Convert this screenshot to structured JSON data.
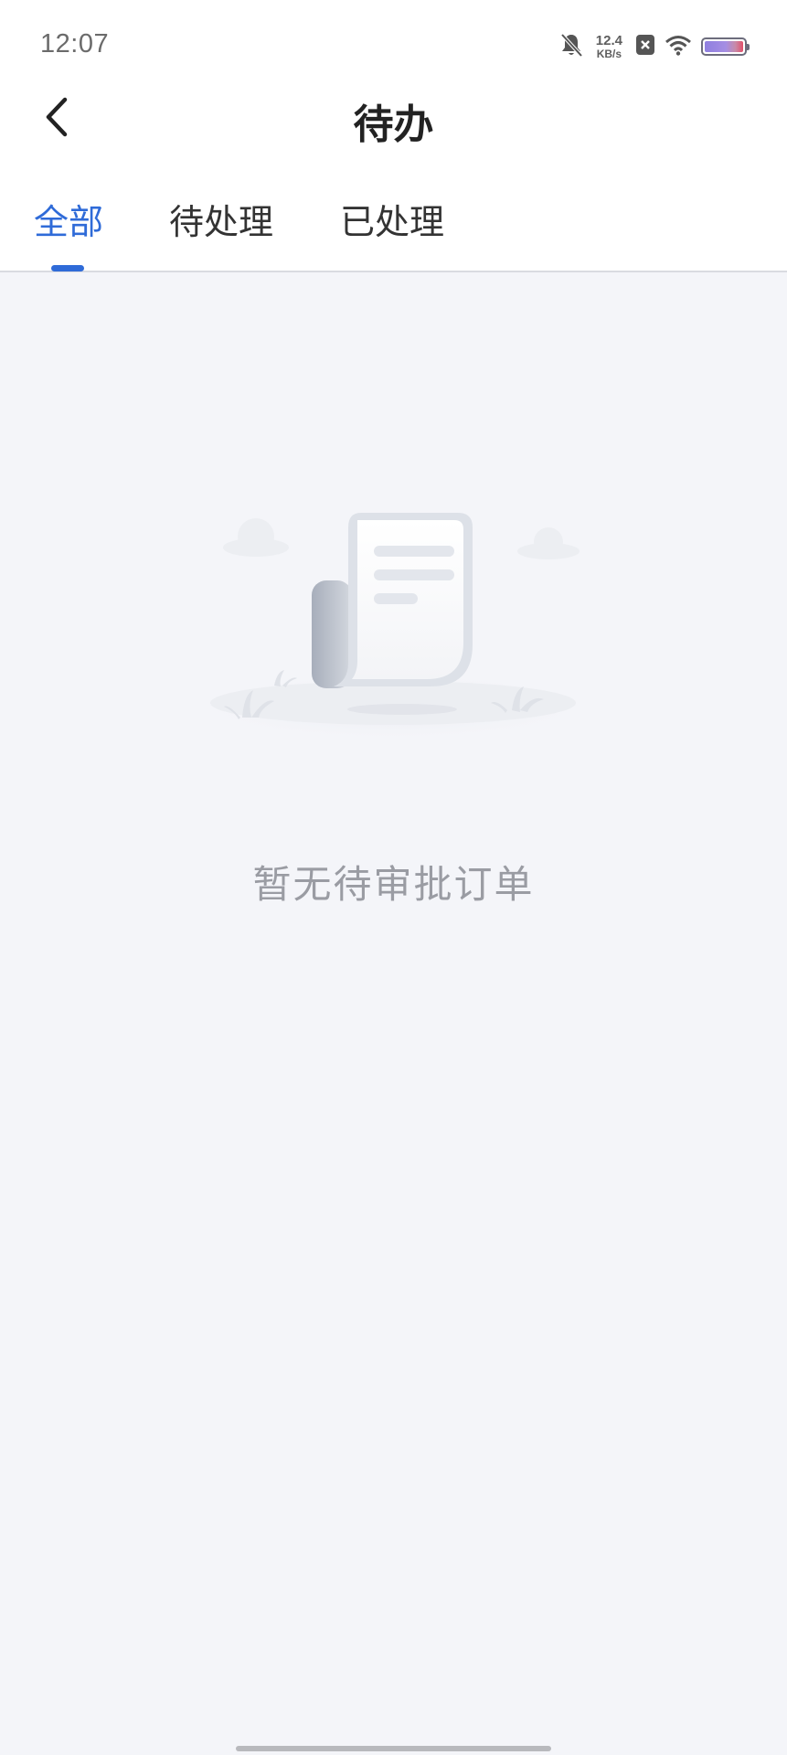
{
  "status_bar": {
    "time": "12:07",
    "net_speed_value": "12.4",
    "net_speed_unit": "KB/s",
    "icons": [
      "bell-muted-icon",
      "close-box-icon",
      "wifi-icon",
      "battery-icon"
    ]
  },
  "header": {
    "title": "待办",
    "back_icon": "chevron-left-icon"
  },
  "tabs": [
    {
      "label": "全部",
      "active": true
    },
    {
      "label": "待处理",
      "active": false
    },
    {
      "label": "已处理",
      "active": false
    }
  ],
  "empty_state": {
    "message": "暂无待审批订单",
    "icon": "empty-document-illustration"
  },
  "colors": {
    "accent": "#2f6bd8",
    "background": "#f4f5f9",
    "title": "#222222",
    "muted_text": "#9a9ca3"
  }
}
